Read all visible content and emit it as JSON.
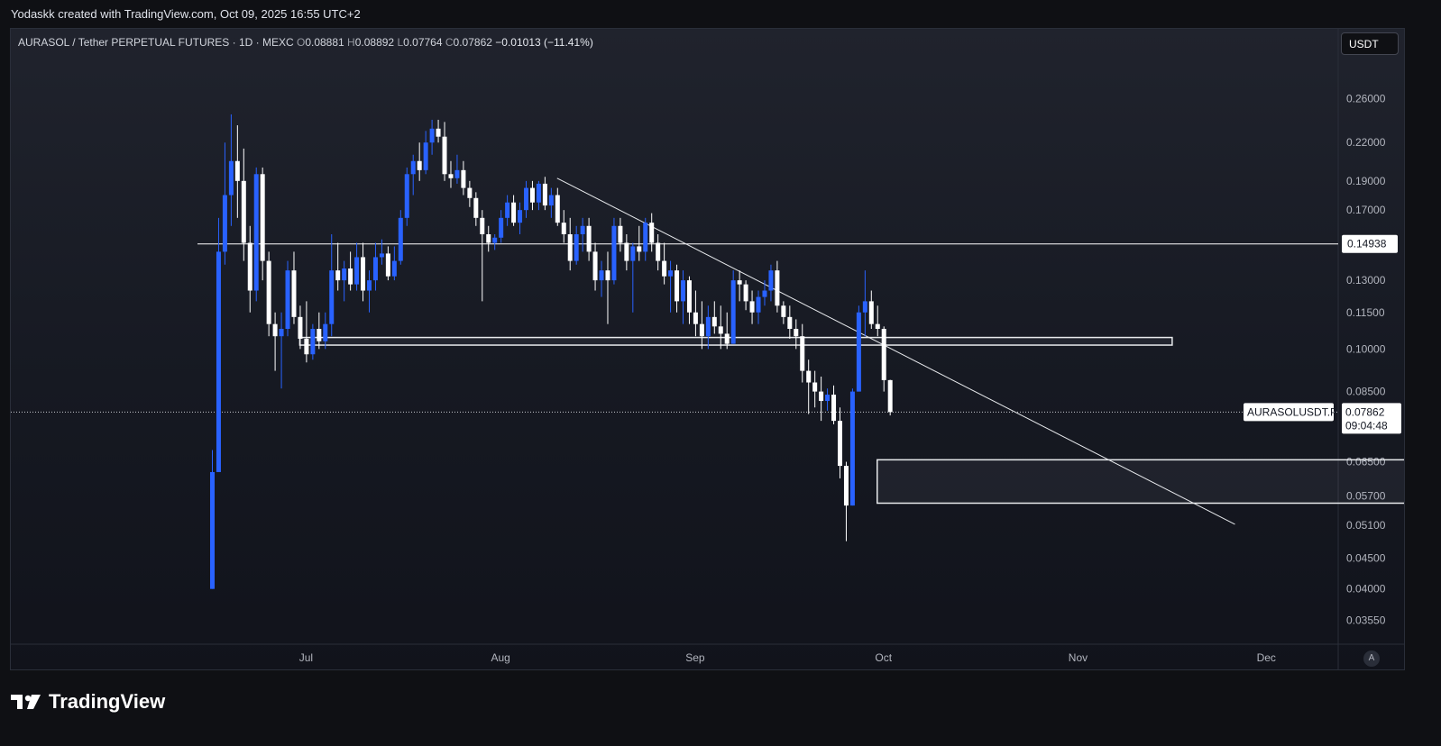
{
  "header": {
    "created_by": "Yodaskk created with TradingView.com, Oct 09, 2025 16:55 UTC+2"
  },
  "legend": {
    "symbol": "AURASOL / Tether PERPETUAL FUTURES · 1D · MEXC",
    "o_label": "O",
    "o": "0.08881",
    "h_label": "H",
    "h": "0.08892",
    "l_label": "L",
    "l": "0.07764",
    "c_label": "C",
    "c": "0.07862",
    "change": "−0.01013 (−11.41%)"
  },
  "currency_button": "USDT",
  "auto_button": "A",
  "brand": {
    "name": "TradingView"
  },
  "colors": {
    "up": "#2962ff",
    "down": "#ffffff",
    "background": "#1a1d27",
    "text": "#d1d4dc"
  },
  "chart_data": {
    "type": "candlestick",
    "price_scale": {
      "log": true,
      "ticks": [
        "0.26000",
        "0.22000",
        "0.19000",
        "0.17000",
        "0.14938",
        "0.13000",
        "0.11500",
        "0.10000",
        "0.08500",
        "0.07862",
        "0.06500",
        "0.05700",
        "0.05100",
        "0.04500",
        "0.04000",
        "0.03550"
      ],
      "tick_values": [
        0.26,
        0.22,
        0.19,
        0.17,
        0.14938,
        0.13,
        0.115,
        0.1,
        0.085,
        0.07862,
        0.065,
        0.057,
        0.051,
        0.045,
        0.04,
        0.0355
      ],
      "range": [
        0.0325,
        0.285
      ]
    },
    "time_axis": {
      "labels": [
        "Jul",
        "Aug",
        "Sep",
        "Oct",
        "Nov",
        "Dec"
      ],
      "start_date": "2025-06-16"
    },
    "price_label": {
      "symbol": "AURASOLUSDT.P",
      "price": "0.07862",
      "countdown": "09:04:48"
    },
    "annotations": {
      "horizontal_line": {
        "price": 0.14938
      },
      "trend_line": {
        "from": [
          "2025-08-10",
          0.192
        ],
        "to": [
          "2025-11-26",
          0.0512
        ]
      },
      "boxes": [
        {
          "from": "2025-06-30",
          "to": "2025-11-16",
          "top": 0.1045,
          "bottom": 0.1015
        },
        {
          "from": "2025-09-30",
          "to": "2025-12-31",
          "top": 0.0655,
          "bottom": 0.0555
        }
      ]
    },
    "candles": [
      [
        0.04,
        0.068,
        0.04,
        0.0625
      ],
      [
        0.0625,
        0.165,
        0.0625,
        0.145
      ],
      [
        0.145,
        0.22,
        0.138,
        0.18
      ],
      [
        0.18,
        0.245,
        0.16,
        0.205
      ],
      [
        0.205,
        0.235,
        0.165,
        0.19
      ],
      [
        0.19,
        0.215,
        0.14,
        0.15
      ],
      [
        0.15,
        0.16,
        0.115,
        0.125
      ],
      [
        0.125,
        0.2,
        0.12,
        0.195
      ],
      [
        0.195,
        0.2,
        0.13,
        0.14
      ],
      [
        0.14,
        0.145,
        0.105,
        0.11
      ],
      [
        0.11,
        0.115,
        0.092,
        0.105
      ],
      [
        0.105,
        0.115,
        0.086,
        0.108
      ],
      [
        0.108,
        0.14,
        0.105,
        0.135
      ],
      [
        0.135,
        0.145,
        0.11,
        0.113
      ],
      [
        0.113,
        0.118,
        0.1,
        0.104
      ],
      [
        0.104,
        0.12,
        0.095,
        0.098
      ],
      [
        0.098,
        0.11,
        0.096,
        0.108
      ],
      [
        0.108,
        0.115,
        0.1,
        0.103
      ],
      [
        0.103,
        0.115,
        0.1,
        0.11
      ],
      [
        0.11,
        0.155,
        0.105,
        0.135
      ],
      [
        0.135,
        0.15,
        0.125,
        0.13
      ],
      [
        0.13,
        0.14,
        0.12,
        0.136
      ],
      [
        0.136,
        0.145,
        0.125,
        0.128
      ],
      [
        0.128,
        0.15,
        0.125,
        0.142
      ],
      [
        0.142,
        0.15,
        0.12,
        0.125
      ],
      [
        0.125,
        0.135,
        0.115,
        0.13
      ],
      [
        0.13,
        0.15,
        0.125,
        0.142
      ],
      [
        0.142,
        0.152,
        0.138,
        0.144
      ],
      [
        0.144,
        0.148,
        0.13,
        0.132
      ],
      [
        0.132,
        0.148,
        0.13,
        0.14
      ],
      [
        0.14,
        0.17,
        0.138,
        0.165
      ],
      [
        0.165,
        0.2,
        0.16,
        0.195
      ],
      [
        0.195,
        0.21,
        0.18,
        0.205
      ],
      [
        0.205,
        0.22,
        0.19,
        0.198
      ],
      [
        0.198,
        0.23,
        0.195,
        0.22
      ],
      [
        0.22,
        0.24,
        0.21,
        0.232
      ],
      [
        0.232,
        0.24,
        0.22,
        0.225
      ],
      [
        0.225,
        0.238,
        0.19,
        0.195
      ],
      [
        0.195,
        0.205,
        0.185,
        0.192
      ],
      [
        0.192,
        0.21,
        0.188,
        0.198
      ],
      [
        0.198,
        0.205,
        0.18,
        0.185
      ],
      [
        0.185,
        0.19,
        0.172,
        0.178
      ],
      [
        0.178,
        0.182,
        0.16,
        0.165
      ],
      [
        0.165,
        0.17,
        0.12,
        0.155
      ],
      [
        0.155,
        0.16,
        0.145,
        0.15
      ],
      [
        0.15,
        0.155,
        0.146,
        0.153
      ],
      [
        0.153,
        0.17,
        0.15,
        0.165
      ],
      [
        0.165,
        0.18,
        0.16,
        0.175
      ],
      [
        0.175,
        0.18,
        0.16,
        0.162
      ],
      [
        0.162,
        0.175,
        0.155,
        0.17
      ],
      [
        0.17,
        0.19,
        0.165,
        0.185
      ],
      [
        0.185,
        0.19,
        0.17,
        0.175
      ],
      [
        0.175,
        0.19,
        0.17,
        0.188
      ],
      [
        0.188,
        0.193,
        0.17,
        0.173
      ],
      [
        0.173,
        0.185,
        0.165,
        0.18
      ],
      [
        0.18,
        0.185,
        0.16,
        0.162
      ],
      [
        0.162,
        0.17,
        0.15,
        0.155
      ],
      [
        0.155,
        0.165,
        0.135,
        0.14
      ],
      [
        0.14,
        0.16,
        0.138,
        0.155
      ],
      [
        0.155,
        0.165,
        0.145,
        0.16
      ],
      [
        0.16,
        0.165,
        0.14,
        0.145
      ],
      [
        0.145,
        0.15,
        0.125,
        0.13
      ],
      [
        0.13,
        0.14,
        0.122,
        0.135
      ],
      [
        0.135,
        0.145,
        0.11,
        0.13
      ],
      [
        0.13,
        0.165,
        0.128,
        0.16
      ],
      [
        0.16,
        0.165,
        0.145,
        0.15
      ],
      [
        0.15,
        0.155,
        0.135,
        0.14
      ],
      [
        0.14,
        0.15,
        0.115,
        0.148
      ],
      [
        0.148,
        0.16,
        0.14,
        0.145
      ],
      [
        0.145,
        0.165,
        0.14,
        0.162
      ],
      [
        0.162,
        0.168,
        0.145,
        0.15
      ],
      [
        0.15,
        0.155,
        0.135,
        0.14
      ],
      [
        0.14,
        0.15,
        0.128,
        0.132
      ],
      [
        0.132,
        0.14,
        0.115,
        0.135
      ],
      [
        0.135,
        0.138,
        0.115,
        0.12
      ],
      [
        0.12,
        0.135,
        0.11,
        0.13
      ],
      [
        0.13,
        0.132,
        0.11,
        0.115
      ],
      [
        0.115,
        0.125,
        0.105,
        0.11
      ],
      [
        0.11,
        0.12,
        0.1,
        0.105
      ],
      [
        0.105,
        0.118,
        0.1,
        0.113
      ],
      [
        0.113,
        0.12,
        0.106,
        0.109
      ],
      [
        0.109,
        0.118,
        0.1,
        0.106
      ],
      [
        0.106,
        0.115,
        0.1,
        0.102
      ],
      [
        0.102,
        0.135,
        0.102,
        0.13
      ],
      [
        0.13,
        0.135,
        0.12,
        0.128
      ],
      [
        0.128,
        0.13,
        0.116,
        0.12
      ],
      [
        0.12,
        0.125,
        0.11,
        0.115
      ],
      [
        0.115,
        0.125,
        0.11,
        0.122
      ],
      [
        0.122,
        0.13,
        0.118,
        0.125
      ],
      [
        0.125,
        0.138,
        0.12,
        0.135
      ],
      [
        0.135,
        0.14,
        0.115,
        0.118
      ],
      [
        0.118,
        0.12,
        0.11,
        0.113
      ],
      [
        0.113,
        0.118,
        0.104,
        0.108
      ],
      [
        0.108,
        0.112,
        0.1,
        0.105
      ],
      [
        0.105,
        0.11,
        0.088,
        0.092
      ],
      [
        0.092,
        0.096,
        0.078,
        0.088
      ],
      [
        0.088,
        0.092,
        0.08,
        0.085
      ],
      [
        0.085,
        0.09,
        0.076,
        0.082
      ],
      [
        0.082,
        0.086,
        0.079,
        0.084
      ],
      [
        0.084,
        0.087,
        0.075,
        0.076
      ],
      [
        0.076,
        0.08,
        0.061,
        0.064
      ],
      [
        0.064,
        0.065,
        0.048,
        0.055
      ],
      [
        0.055,
        0.086,
        0.055,
        0.085
      ],
      [
        0.085,
        0.118,
        0.085,
        0.115
      ],
      [
        0.115,
        0.135,
        0.105,
        0.12
      ],
      [
        0.12,
        0.125,
        0.108,
        0.11
      ],
      [
        0.11,
        0.118,
        0.105,
        0.108
      ],
      [
        0.108,
        0.109,
        0.085,
        0.0888
      ],
      [
        0.0888,
        0.0889,
        0.0776,
        0.0786
      ]
    ]
  }
}
